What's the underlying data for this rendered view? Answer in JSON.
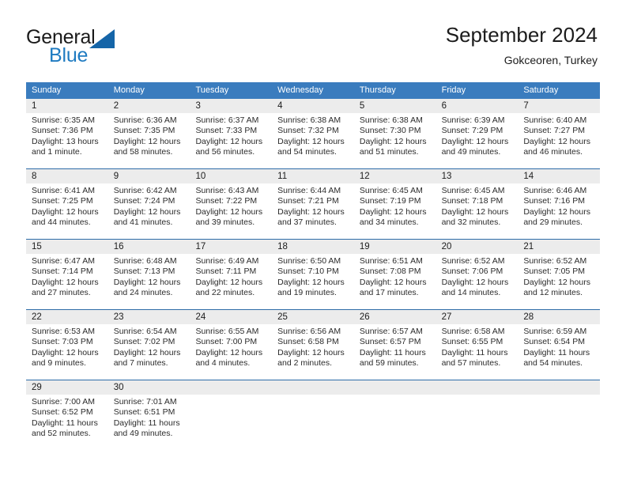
{
  "brand": {
    "name_top": "General",
    "name_bottom": "Blue",
    "triangle_color": "#1565a8",
    "blue_color": "#1f7bc1"
  },
  "header": {
    "title": "September 2024",
    "subtitle": "Gokceoren, Turkey"
  },
  "theme": {
    "header_row_bg": "#3a7cbe",
    "daynum_bg": "#ececec",
    "week_divider": "#2e6ca8",
    "text": "#1c1c1c"
  },
  "weekdays": [
    "Sunday",
    "Monday",
    "Tuesday",
    "Wednesday",
    "Thursday",
    "Friday",
    "Saturday"
  ],
  "chart_data": {
    "type": "table",
    "title": "September 2024 — Gokceoren, Turkey sunrise/sunset table",
    "columns": [
      "Sunday",
      "Monday",
      "Tuesday",
      "Wednesday",
      "Thursday",
      "Friday",
      "Saturday"
    ],
    "rows": 5
  },
  "weeks": [
    {
      "days": [
        {
          "num": "1",
          "sunrise": "Sunrise: 6:35 AM",
          "sunset": "Sunset: 7:36 PM",
          "daylight1": "Daylight: 13 hours",
          "daylight2": "and 1 minute."
        },
        {
          "num": "2",
          "sunrise": "Sunrise: 6:36 AM",
          "sunset": "Sunset: 7:35 PM",
          "daylight1": "Daylight: 12 hours",
          "daylight2": "and 58 minutes."
        },
        {
          "num": "3",
          "sunrise": "Sunrise: 6:37 AM",
          "sunset": "Sunset: 7:33 PM",
          "daylight1": "Daylight: 12 hours",
          "daylight2": "and 56 minutes."
        },
        {
          "num": "4",
          "sunrise": "Sunrise: 6:38 AM",
          "sunset": "Sunset: 7:32 PM",
          "daylight1": "Daylight: 12 hours",
          "daylight2": "and 54 minutes."
        },
        {
          "num": "5",
          "sunrise": "Sunrise: 6:38 AM",
          "sunset": "Sunset: 7:30 PM",
          "daylight1": "Daylight: 12 hours",
          "daylight2": "and 51 minutes."
        },
        {
          "num": "6",
          "sunrise": "Sunrise: 6:39 AM",
          "sunset": "Sunset: 7:29 PM",
          "daylight1": "Daylight: 12 hours",
          "daylight2": "and 49 minutes."
        },
        {
          "num": "7",
          "sunrise": "Sunrise: 6:40 AM",
          "sunset": "Sunset: 7:27 PM",
          "daylight1": "Daylight: 12 hours",
          "daylight2": "and 46 minutes."
        }
      ]
    },
    {
      "days": [
        {
          "num": "8",
          "sunrise": "Sunrise: 6:41 AM",
          "sunset": "Sunset: 7:25 PM",
          "daylight1": "Daylight: 12 hours",
          "daylight2": "and 44 minutes."
        },
        {
          "num": "9",
          "sunrise": "Sunrise: 6:42 AM",
          "sunset": "Sunset: 7:24 PM",
          "daylight1": "Daylight: 12 hours",
          "daylight2": "and 41 minutes."
        },
        {
          "num": "10",
          "sunrise": "Sunrise: 6:43 AM",
          "sunset": "Sunset: 7:22 PM",
          "daylight1": "Daylight: 12 hours",
          "daylight2": "and 39 minutes."
        },
        {
          "num": "11",
          "sunrise": "Sunrise: 6:44 AM",
          "sunset": "Sunset: 7:21 PM",
          "daylight1": "Daylight: 12 hours",
          "daylight2": "and 37 minutes."
        },
        {
          "num": "12",
          "sunrise": "Sunrise: 6:45 AM",
          "sunset": "Sunset: 7:19 PM",
          "daylight1": "Daylight: 12 hours",
          "daylight2": "and 34 minutes."
        },
        {
          "num": "13",
          "sunrise": "Sunrise: 6:45 AM",
          "sunset": "Sunset: 7:18 PM",
          "daylight1": "Daylight: 12 hours",
          "daylight2": "and 32 minutes."
        },
        {
          "num": "14",
          "sunrise": "Sunrise: 6:46 AM",
          "sunset": "Sunset: 7:16 PM",
          "daylight1": "Daylight: 12 hours",
          "daylight2": "and 29 minutes."
        }
      ]
    },
    {
      "days": [
        {
          "num": "15",
          "sunrise": "Sunrise: 6:47 AM",
          "sunset": "Sunset: 7:14 PM",
          "daylight1": "Daylight: 12 hours",
          "daylight2": "and 27 minutes."
        },
        {
          "num": "16",
          "sunrise": "Sunrise: 6:48 AM",
          "sunset": "Sunset: 7:13 PM",
          "daylight1": "Daylight: 12 hours",
          "daylight2": "and 24 minutes."
        },
        {
          "num": "17",
          "sunrise": "Sunrise: 6:49 AM",
          "sunset": "Sunset: 7:11 PM",
          "daylight1": "Daylight: 12 hours",
          "daylight2": "and 22 minutes."
        },
        {
          "num": "18",
          "sunrise": "Sunrise: 6:50 AM",
          "sunset": "Sunset: 7:10 PM",
          "daylight1": "Daylight: 12 hours",
          "daylight2": "and 19 minutes."
        },
        {
          "num": "19",
          "sunrise": "Sunrise: 6:51 AM",
          "sunset": "Sunset: 7:08 PM",
          "daylight1": "Daylight: 12 hours",
          "daylight2": "and 17 minutes."
        },
        {
          "num": "20",
          "sunrise": "Sunrise: 6:52 AM",
          "sunset": "Sunset: 7:06 PM",
          "daylight1": "Daylight: 12 hours",
          "daylight2": "and 14 minutes."
        },
        {
          "num": "21",
          "sunrise": "Sunrise: 6:52 AM",
          "sunset": "Sunset: 7:05 PM",
          "daylight1": "Daylight: 12 hours",
          "daylight2": "and 12 minutes."
        }
      ]
    },
    {
      "days": [
        {
          "num": "22",
          "sunrise": "Sunrise: 6:53 AM",
          "sunset": "Sunset: 7:03 PM",
          "daylight1": "Daylight: 12 hours",
          "daylight2": "and 9 minutes."
        },
        {
          "num": "23",
          "sunrise": "Sunrise: 6:54 AM",
          "sunset": "Sunset: 7:02 PM",
          "daylight1": "Daylight: 12 hours",
          "daylight2": "and 7 minutes."
        },
        {
          "num": "24",
          "sunrise": "Sunrise: 6:55 AM",
          "sunset": "Sunset: 7:00 PM",
          "daylight1": "Daylight: 12 hours",
          "daylight2": "and 4 minutes."
        },
        {
          "num": "25",
          "sunrise": "Sunrise: 6:56 AM",
          "sunset": "Sunset: 6:58 PM",
          "daylight1": "Daylight: 12 hours",
          "daylight2": "and 2 minutes."
        },
        {
          "num": "26",
          "sunrise": "Sunrise: 6:57 AM",
          "sunset": "Sunset: 6:57 PM",
          "daylight1": "Daylight: 11 hours",
          "daylight2": "and 59 minutes."
        },
        {
          "num": "27",
          "sunrise": "Sunrise: 6:58 AM",
          "sunset": "Sunset: 6:55 PM",
          "daylight1": "Daylight: 11 hours",
          "daylight2": "and 57 minutes."
        },
        {
          "num": "28",
          "sunrise": "Sunrise: 6:59 AM",
          "sunset": "Sunset: 6:54 PM",
          "daylight1": "Daylight: 11 hours",
          "daylight2": "and 54 minutes."
        }
      ]
    },
    {
      "days": [
        {
          "num": "29",
          "sunrise": "Sunrise: 7:00 AM",
          "sunset": "Sunset: 6:52 PM",
          "daylight1": "Daylight: 11 hours",
          "daylight2": "and 52 minutes."
        },
        {
          "num": "30",
          "sunrise": "Sunrise: 7:01 AM",
          "sunset": "Sunset: 6:51 PM",
          "daylight1": "Daylight: 11 hours",
          "daylight2": "and 49 minutes."
        },
        {
          "num": "",
          "sunrise": "",
          "sunset": "",
          "daylight1": "",
          "daylight2": ""
        },
        {
          "num": "",
          "sunrise": "",
          "sunset": "",
          "daylight1": "",
          "daylight2": ""
        },
        {
          "num": "",
          "sunrise": "",
          "sunset": "",
          "daylight1": "",
          "daylight2": ""
        },
        {
          "num": "",
          "sunrise": "",
          "sunset": "",
          "daylight1": "",
          "daylight2": ""
        },
        {
          "num": "",
          "sunrise": "",
          "sunset": "",
          "daylight1": "",
          "daylight2": ""
        }
      ]
    }
  ]
}
